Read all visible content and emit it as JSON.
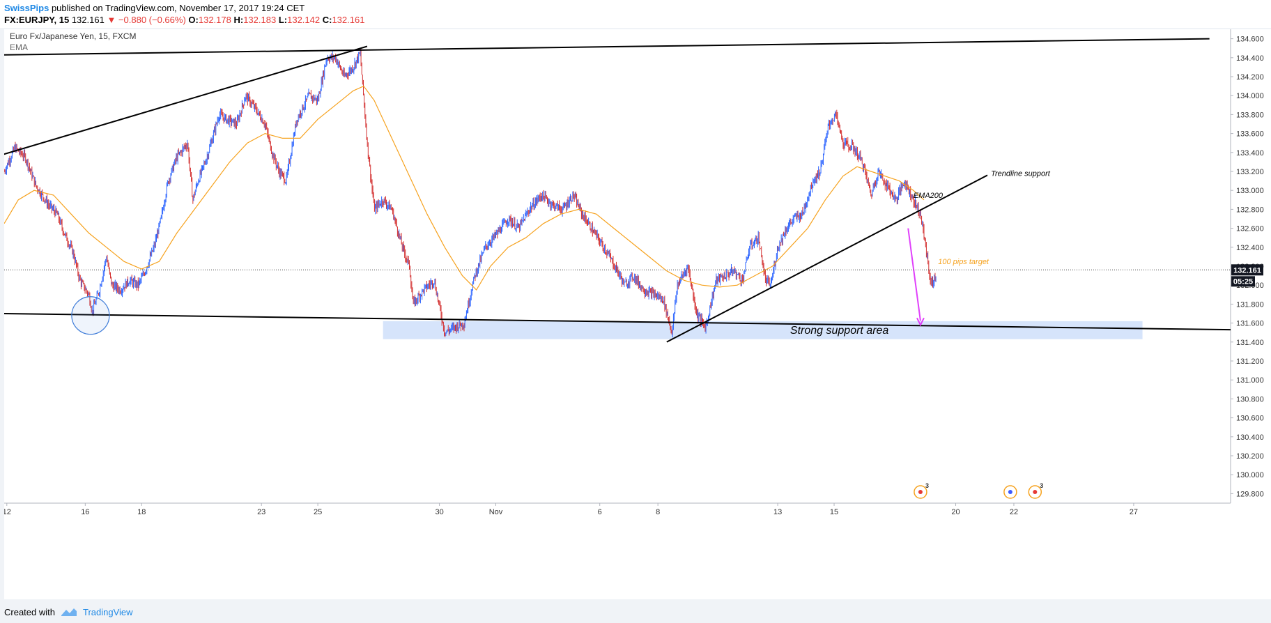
{
  "header": {
    "publisher": "SwissPips",
    "published_text": "published on TradingView.com, November 17, 2017 19:24 CET",
    "symbol": "FX:EURJPY, 15",
    "last": "132.161",
    "change": "▼ −0.880 (−0.66%)",
    "o_label": "O:",
    "o_value": "132.178",
    "h_label": "H:",
    "h_value": "132.183",
    "l_label": "L:",
    "l_value": "132.142",
    "c_label": "C:",
    "c_value": "132.161"
  },
  "footer": {
    "created_with": "Created with",
    "brand": "TradingView"
  },
  "colors": {
    "bull": "#2962ff",
    "bear": "#d32f2f",
    "ema": "#f6a21e",
    "support_fill": "#d6e4fb",
    "target": "#f6a21e",
    "arrow": "#e040fb",
    "price_label": "#131722"
  },
  "chart_data": {
    "type": "candlestick",
    "legend_title": "Euro Fx/Japanese Yen, 15, FXCM",
    "indicator_label": "EMA",
    "y_axis": {
      "min": 129.7,
      "max": 134.7,
      "ticks": [
        "129.800",
        "130.000",
        "130.200",
        "130.400",
        "130.600",
        "130.800",
        "131.000",
        "131.200",
        "131.400",
        "131.600",
        "131.800",
        "132.000",
        "132.200",
        "132.400",
        "132.600",
        "132.800",
        "133.000",
        "133.200",
        "133.400",
        "133.600",
        "133.800",
        "134.000",
        "134.200",
        "134.400",
        "134.600"
      ]
    },
    "x_axis": {
      "ticks": [
        {
          "label": "12",
          "x": 0.15
        },
        {
          "label": "16",
          "x": 4.6
        },
        {
          "label": "18",
          "x": 7.8
        },
        {
          "label": "23",
          "x": 14.6
        },
        {
          "label": "25",
          "x": 17.8
        },
        {
          "label": "30",
          "x": 24.7
        },
        {
          "label": "Nov",
          "x": 27.9
        },
        {
          "label": "6",
          "x": 33.8
        },
        {
          "label": "8",
          "x": 37.1
        },
        {
          "label": "13",
          "x": 43.9
        },
        {
          "label": "15",
          "x": 47.1
        },
        {
          "label": "20",
          "x": 54.0
        },
        {
          "label": "22",
          "x": 57.3
        },
        {
          "label": "27",
          "x": 64.1
        }
      ],
      "max": 69.6
    },
    "price_path": [
      [
        0,
        133.2
      ],
      [
        0.6,
        133.45
      ],
      [
        1.2,
        133.35
      ],
      [
        1.8,
        133.05
      ],
      [
        2.5,
        132.85
      ],
      [
        3.0,
        132.75
      ],
      [
        3.4,
        132.55
      ],
      [
        3.9,
        132.35
      ],
      [
        4.3,
        132.05
      ],
      [
        4.8,
        131.9
      ],
      [
        5.0,
        131.72
      ],
      [
        5.4,
        131.95
      ],
      [
        5.8,
        132.3
      ],
      [
        6.1,
        132.0
      ],
      [
        6.6,
        131.95
      ],
      [
        7.1,
        132.05
      ],
      [
        7.6,
        132.0
      ],
      [
        8.0,
        132.15
      ],
      [
        8.5,
        132.4
      ],
      [
        8.9,
        132.7
      ],
      [
        9.3,
        133.1
      ],
      [
        9.8,
        133.35
      ],
      [
        10.4,
        133.5
      ],
      [
        10.7,
        132.9
      ],
      [
        11.0,
        133.1
      ],
      [
        11.5,
        133.35
      ],
      [
        12.2,
        133.8
      ],
      [
        12.6,
        133.75
      ],
      [
        13.2,
        133.7
      ],
      [
        13.7,
        134.0
      ],
      [
        14.3,
        133.85
      ],
      [
        14.8,
        133.7
      ],
      [
        15.2,
        133.4
      ],
      [
        15.6,
        133.2
      ],
      [
        16.0,
        133.1
      ],
      [
        16.6,
        133.75
      ],
      [
        17.3,
        134.0
      ],
      [
        17.8,
        133.95
      ],
      [
        18.3,
        134.4
      ],
      [
        18.8,
        134.4
      ],
      [
        19.3,
        134.2
      ],
      [
        19.8,
        134.3
      ],
      [
        20.2,
        134.45
      ],
      [
        20.6,
        133.5
      ],
      [
        21.0,
        132.8
      ],
      [
        21.5,
        132.9
      ],
      [
        22.0,
        132.8
      ],
      [
        22.6,
        132.4
      ],
      [
        23.0,
        132.2
      ],
      [
        23.2,
        131.8
      ],
      [
        23.8,
        131.95
      ],
      [
        24.4,
        132.05
      ],
      [
        25.0,
        131.5
      ],
      [
        25.5,
        131.55
      ],
      [
        26.1,
        131.6
      ],
      [
        26.7,
        132.1
      ],
      [
        27.3,
        132.4
      ],
      [
        28.0,
        132.55
      ],
      [
        28.6,
        132.7
      ],
      [
        29.2,
        132.6
      ],
      [
        29.8,
        132.8
      ],
      [
        30.5,
        132.95
      ],
      [
        31.1,
        132.85
      ],
      [
        31.7,
        132.8
      ],
      [
        32.3,
        132.95
      ],
      [
        32.8,
        132.75
      ],
      [
        33.5,
        132.55
      ],
      [
        34.2,
        132.35
      ],
      [
        34.8,
        132.15
      ],
      [
        35.2,
        132.0
      ],
      [
        35.7,
        132.1
      ],
      [
        36.3,
        131.95
      ],
      [
        36.9,
        131.9
      ],
      [
        37.4,
        131.85
      ],
      [
        37.9,
        131.5
      ],
      [
        38.2,
        132.0
      ],
      [
        38.8,
        132.2
      ],
      [
        39.3,
        131.7
      ],
      [
        39.8,
        131.55
      ],
      [
        40.4,
        132.05
      ],
      [
        40.9,
        132.1
      ],
      [
        41.4,
        132.15
      ],
      [
        41.9,
        132.05
      ],
      [
        42.3,
        132.4
      ],
      [
        42.8,
        132.5
      ],
      [
        43.2,
        132.05
      ],
      [
        43.5,
        132.0
      ],
      [
        43.9,
        132.4
      ],
      [
        44.4,
        132.6
      ],
      [
        44.8,
        132.7
      ],
      [
        45.3,
        132.75
      ],
      [
        45.9,
        133.1
      ],
      [
        46.3,
        133.2
      ],
      [
        46.8,
        133.7
      ],
      [
        47.2,
        133.8
      ],
      [
        47.6,
        133.5
      ],
      [
        48.2,
        133.45
      ],
      [
        48.7,
        133.3
      ],
      [
        49.2,
        132.95
      ],
      [
        49.6,
        133.2
      ],
      [
        50.1,
        133.05
      ],
      [
        50.6,
        132.9
      ],
      [
        51.1,
        133.1
      ],
      [
        51.6,
        132.9
      ],
      [
        52.0,
        132.75
      ],
      [
        52.3,
        132.4
      ],
      [
        52.6,
        132.0
      ],
      [
        52.9,
        132.1
      ]
    ],
    "ema_path": [
      [
        0,
        132.65
      ],
      [
        0.8,
        132.9
      ],
      [
        1.7,
        133.0
      ],
      [
        2.8,
        132.95
      ],
      [
        3.8,
        132.75
      ],
      [
        4.8,
        132.55
      ],
      [
        5.8,
        132.4
      ],
      [
        6.8,
        132.25
      ],
      [
        7.8,
        132.17
      ],
      [
        8.8,
        132.25
      ],
      [
        9.8,
        132.55
      ],
      [
        10.8,
        132.8
      ],
      [
        11.8,
        133.05
      ],
      [
        12.8,
        133.3
      ],
      [
        13.8,
        133.5
      ],
      [
        14.8,
        133.6
      ],
      [
        15.8,
        133.55
      ],
      [
        16.8,
        133.55
      ],
      [
        17.8,
        133.75
      ],
      [
        18.8,
        133.9
      ],
      [
        19.8,
        134.05
      ],
      [
        20.4,
        134.1
      ],
      [
        21.0,
        133.95
      ],
      [
        22.0,
        133.55
      ],
      [
        23.0,
        133.15
      ],
      [
        24.0,
        132.75
      ],
      [
        25.0,
        132.4
      ],
      [
        26.0,
        132.1
      ],
      [
        26.8,
        131.95
      ],
      [
        27.6,
        132.2
      ],
      [
        28.6,
        132.4
      ],
      [
        29.6,
        132.5
      ],
      [
        30.6,
        132.65
      ],
      [
        31.6,
        132.75
      ],
      [
        32.6,
        132.8
      ],
      [
        33.6,
        132.75
      ],
      [
        34.6,
        132.6
      ],
      [
        35.6,
        132.45
      ],
      [
        36.6,
        132.3
      ],
      [
        37.6,
        132.15
      ],
      [
        38.6,
        132.05
      ],
      [
        39.6,
        132.0
      ],
      [
        40.6,
        131.98
      ],
      [
        41.6,
        132.0
      ],
      [
        42.6,
        132.1
      ],
      [
        43.6,
        132.2
      ],
      [
        44.6,
        132.4
      ],
      [
        45.6,
        132.6
      ],
      [
        46.6,
        132.9
      ],
      [
        47.6,
        133.15
      ],
      [
        48.4,
        133.25
      ],
      [
        49.2,
        133.2
      ],
      [
        50.0,
        133.15
      ],
      [
        50.8,
        133.1
      ],
      [
        51.6,
        133.0
      ],
      [
        52.2,
        132.9
      ]
    ],
    "trendlines": [
      {
        "x1": -0.05,
        "y1": 134.43,
        "x2": 68.4,
        "y2": 134.6
      },
      {
        "x1": -0.05,
        "y1": 133.38,
        "x2": 20.6,
        "y2": 134.52
      },
      {
        "x1": -0.05,
        "y1": 131.7,
        "x2": 69.6,
        "y2": 131.53
      },
      {
        "x1": 37.6,
        "y1": 131.4,
        "x2": 55.8,
        "y2": 133.16
      }
    ],
    "support_zone": {
      "x1": 21.5,
      "x2": 64.6,
      "y_low": 131.43,
      "y_high": 131.62,
      "label": "Strong support area"
    },
    "annotations": [
      {
        "text": "Trendline support",
        "x": 56.0,
        "y": 133.18
      },
      {
        "text": "EMA200",
        "x": 51.6,
        "y": 132.95
      },
      {
        "text": "100 pips target",
        "x": 53.0,
        "y": 132.25
      }
    ],
    "arrow": {
      "x1": 51.3,
      "y1": 132.6,
      "x2": 52.0,
      "y2": 131.58
    },
    "circle": {
      "x": 4.9,
      "y": 131.68
    },
    "last_price": "132.161",
    "countdown": "05:25",
    "event_icons": [
      {
        "x": 52.0,
        "badge": "3"
      },
      {
        "x": 57.1,
        "badge": ""
      },
      {
        "x": 58.5,
        "badge": "3"
      }
    ]
  }
}
